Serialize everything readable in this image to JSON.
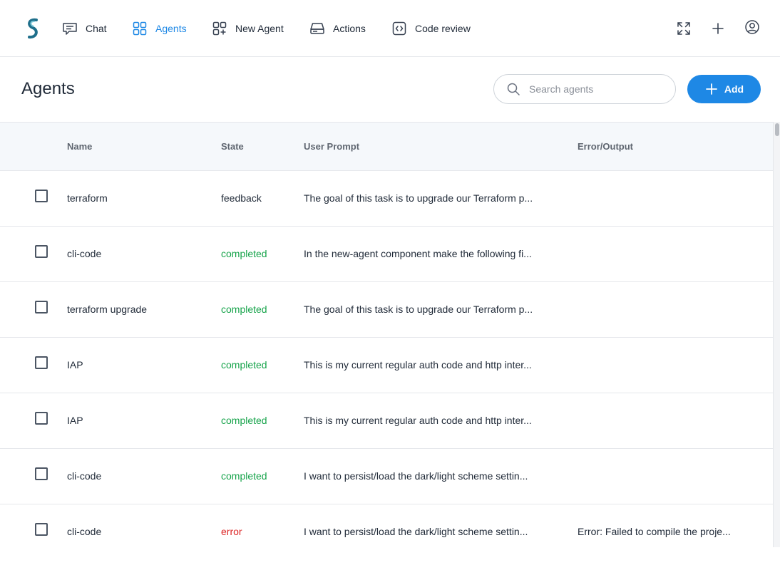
{
  "nav": {
    "items": [
      {
        "label": "Chat"
      },
      {
        "label": "Agents"
      },
      {
        "label": "New Agent"
      },
      {
        "label": "Actions"
      },
      {
        "label": "Code review"
      }
    ]
  },
  "header": {
    "title": "Agents",
    "search_placeholder": "Search agents",
    "add_label": "Add"
  },
  "table": {
    "columns": [
      "Name",
      "State",
      "User Prompt",
      "Error/Output"
    ],
    "rows": [
      {
        "name": "terraform",
        "state": "feedback",
        "prompt": "The goal of this task is to upgrade our Terraform p...",
        "output": ""
      },
      {
        "name": "cli-code",
        "state": "completed",
        "prompt": "In the new-agent component make the following fi...",
        "output": ""
      },
      {
        "name": "terraform upgrade",
        "state": "completed",
        "prompt": "The goal of this task is to upgrade our Terraform p...",
        "output": ""
      },
      {
        "name": "IAP",
        "state": "completed",
        "prompt": "This is my current regular auth code and http inter...",
        "output": ""
      },
      {
        "name": "IAP",
        "state": "completed",
        "prompt": "This is my current regular auth code and http inter...",
        "output": ""
      },
      {
        "name": "cli-code",
        "state": "completed",
        "prompt": "I want to persist/load the dark/light scheme settin...",
        "output": ""
      },
      {
        "name": "cli-code",
        "state": "error",
        "prompt": "I want to persist/load the dark/light scheme settin...",
        "output": "Error: Failed to compile the proje..."
      }
    ]
  },
  "colors": {
    "accent": "#1e88e5",
    "completed": "#16a34a",
    "error": "#dc2626"
  }
}
